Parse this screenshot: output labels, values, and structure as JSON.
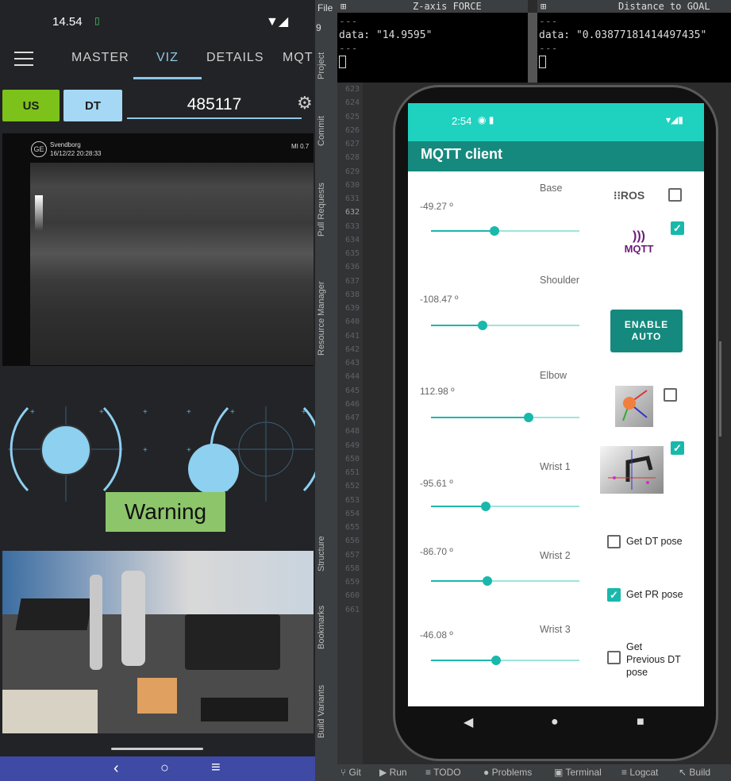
{
  "left_app": {
    "status": {
      "time": "14.54"
    },
    "tabs": [
      "MASTER",
      "VIZ",
      "DETAILS",
      "MQT"
    ],
    "active_tab": "VIZ",
    "mode_buttons": {
      "us": "US",
      "dt": "DT"
    },
    "id_value": "485117",
    "ultrasound": {
      "site": "Svendborg",
      "datetime": "16/12/22 20:28:33",
      "mi": "MI 0.7"
    },
    "warning_label": "Warning",
    "colors": {
      "us_button": "#7cc21a",
      "dt_button": "#a5d8f5",
      "joystick": "#8dd0f0",
      "warning": "#8dc56b",
      "navbar": "#3f4aa4"
    }
  },
  "ide": {
    "menu_file": "File",
    "dropdown": "9",
    "terminals": [
      {
        "title": "Z-axis FORCE",
        "lines": [
          "---",
          "data: \"14.9595\"",
          "---"
        ]
      },
      {
        "title": "Distance to GOAL",
        "lines": [
          "---",
          "data: \"0.03877181414497435\"",
          "---"
        ]
      }
    ],
    "side_tabs": [
      "Project",
      "Commit",
      "Pull Requests",
      "Resource Manager",
      "Structure",
      "Bookmarks",
      "Build Variants"
    ],
    "line_numbers": [
      "623",
      "624",
      "625",
      "626",
      "627",
      "628",
      "629",
      "630",
      "631",
      "632",
      "633",
      "634",
      "635",
      "636",
      "637",
      "638",
      "639",
      "640",
      "641",
      "642",
      "643",
      "644",
      "645",
      "646",
      "647",
      "648",
      "649",
      "650",
      "651",
      "652",
      "653",
      "654",
      "655",
      "656",
      "657",
      "658",
      "659",
      "660",
      "661"
    ],
    "bottom_tools": [
      "Git",
      "Run",
      "TODO",
      "Problems",
      "Terminal",
      "Logcat",
      "Build"
    ]
  },
  "emulator": {
    "status_time": "2:54",
    "app_title": "MQTT client",
    "joints": [
      {
        "name": "Base",
        "value": "-49.27 º",
        "fraction": 0.43
      },
      {
        "name": "Shoulder",
        "value": "-108.47 º",
        "fraction": 0.35
      },
      {
        "name": "Elbow",
        "value": "112.98 º",
        "fraction": 0.66
      },
      {
        "name": "Wrist 1",
        "value": "-95.61 º",
        "fraction": 0.37
      },
      {
        "name": "Wrist 2",
        "value": "-86.70 º",
        "fraction": 0.38
      },
      {
        "name": "Wrist 3",
        "value": "-46.08 º",
        "fraction": 0.44
      }
    ],
    "ros_label": "ROS",
    "mqtt_label": "MQTT",
    "enable_auto": "ENABLE AUTO",
    "checks": {
      "ros": false,
      "mqtt": true,
      "frame": false,
      "robot": true
    },
    "pose_options": [
      {
        "label": "Get DT pose",
        "checked": false
      },
      {
        "label": "Get PR pose",
        "checked": true
      },
      {
        "label": "Get Previous DT pose",
        "checked": false
      }
    ],
    "colors": {
      "status": "#1fd2c0",
      "appbar": "#16897e",
      "accent": "#1ab8ab"
    }
  }
}
